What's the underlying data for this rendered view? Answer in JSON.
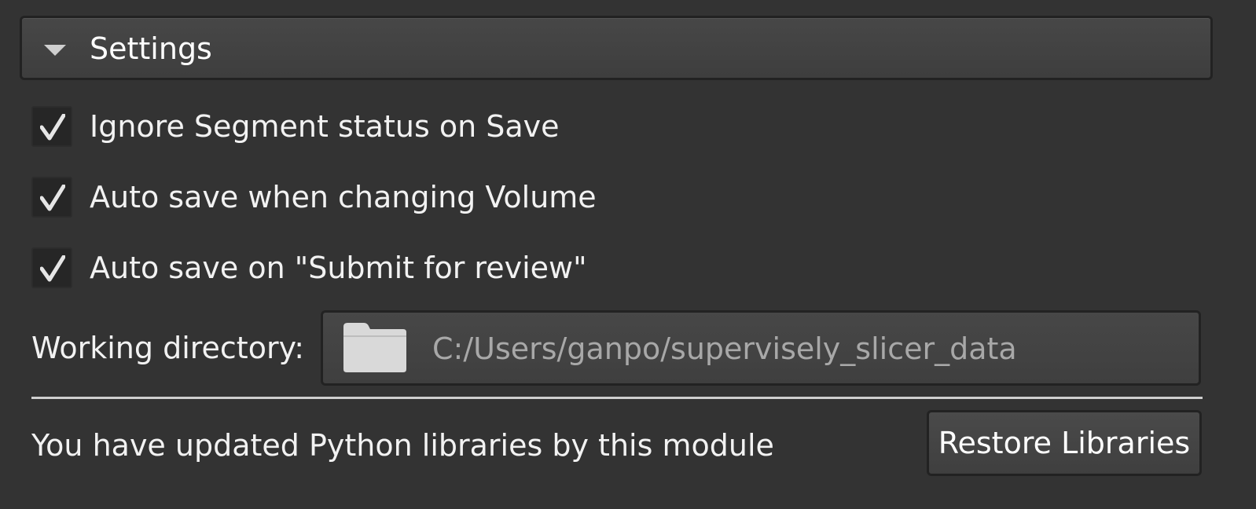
{
  "settings": {
    "title": "Settings",
    "expanded": true
  },
  "checkboxes": [
    {
      "label": "Ignore Segment status on Save",
      "checked": true
    },
    {
      "label": "Auto save when changing Volume",
      "checked": true
    },
    {
      "label": "Auto save on \"Submit for review\"",
      "checked": true
    }
  ],
  "working_directory": {
    "label": "Working directory:",
    "path": "C:/Users/ganpo/supervisely_slicer_data",
    "icon": "folder-icon"
  },
  "libraries": {
    "notice": "You have updated Python libraries by this module",
    "restore_label": "Restore Libraries"
  },
  "colors": {
    "background": "#333333",
    "text": "#f2f2f2",
    "path_text": "#a8a8a8",
    "check": "#e6e6e6"
  }
}
